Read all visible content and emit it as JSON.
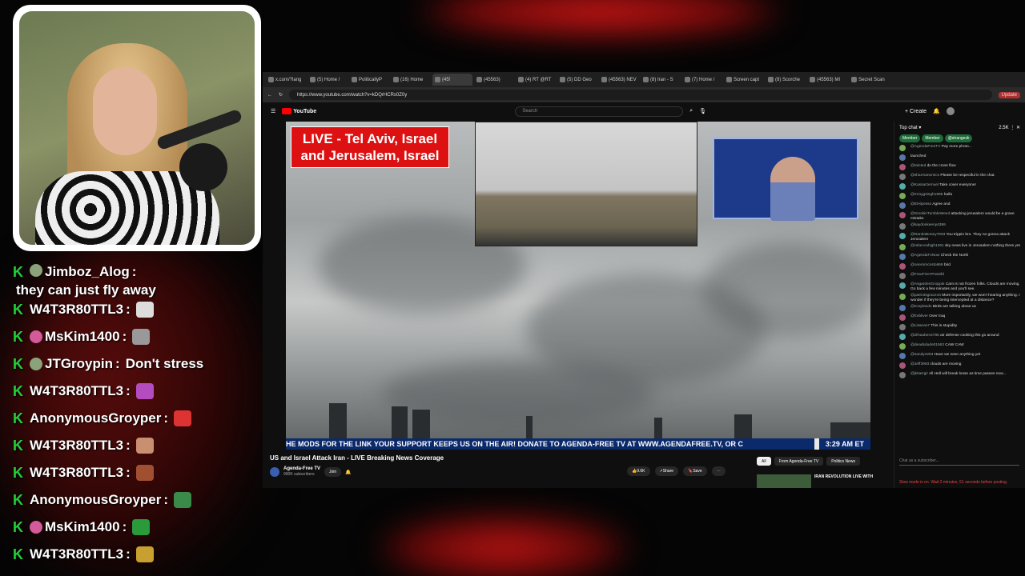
{
  "stream_chat": [
    {
      "user": "Jimboz_Alog",
      "msg": "they can just fly away",
      "badge": "g",
      "emote": ""
    },
    {
      "user": "W4T3R80TTL3",
      "msg": "",
      "badge": "",
      "emote": "#ddd"
    },
    {
      "user": "MsKim1400",
      "msg": "",
      "badge": "p",
      "emote": "#999"
    },
    {
      "user": "JTGroypin",
      "msg": "Don't stress",
      "badge": "g",
      "emote": ""
    },
    {
      "user": "W4T3R80TTL3",
      "msg": "",
      "badge": "",
      "emote": "#b44cc0"
    },
    {
      "user": "AnonymousGroyper",
      "msg": "",
      "badge": "",
      "emote": "#d33"
    },
    {
      "user": "W4T3R80TTL3",
      "msg": "",
      "badge": "",
      "emote": "#c89070"
    },
    {
      "user": "W4T3R80TTL3",
      "msg": "",
      "badge": "",
      "emote": "#a05030"
    },
    {
      "user": "AnonymousGroyper",
      "msg": "",
      "badge": "",
      "emote": "#3a8a4a"
    },
    {
      "user": "MsKim1400",
      "msg": "",
      "badge": "p",
      "emote": "#2a9a3a"
    },
    {
      "user": "W4T3R80TTL3",
      "msg": "",
      "badge": "",
      "emote": "#c8a030"
    }
  ],
  "browser": {
    "tabs": [
      "x.com/?lang",
      "(5) Home /",
      "PoliticallyP",
      "(16) Home",
      "(45!",
      "(45563)",
      "(4) RT @RT",
      "(5) DD Geo",
      "(45563) NEV",
      "(8) Iran - S",
      "(7) Home /",
      "Screen capt",
      "(8) Scorche",
      "(45563) MI",
      "Secret Scan"
    ],
    "url": "https://www.youtube.com/watch?v=kDQrHCRs0Z0y",
    "yt_logo": "YouTube",
    "search_placeholder": "Search",
    "create_label": "Create",
    "update_label": "Update"
  },
  "video": {
    "overlay_title": "LIVE - Tel Aviv, Israel and Jerusalem, Israel",
    "ticker": "HE MODS FOR THE LINK    YOUR SUPPORT KEEPS US ON THE AIR! DONATE TO AGENDA-FREE TV AT WWW.AGENDAFREE.TV, OR C",
    "time": "3:29 AM ET",
    "title": "US and Israel Attack Iran - LIVE Breaking News Coverage",
    "channel": "Agenda-Free TV",
    "subscribers": "990K subscribers",
    "join": "Join",
    "likes": "9.6K",
    "share": "Share",
    "save": "Save"
  },
  "related": {
    "chips": [
      "All",
      "From Agenda-Free TV",
      "Politics News"
    ],
    "first_title": "IRAN REVOLUTION LIVE WITH"
  },
  "live_chat": {
    "header": "Top chat",
    "count": "2.5K",
    "pinned": [
      "Member",
      "Member",
      "@strangesk"
    ],
    "messages": [
      {
        "u": "@AgendaFreeTV",
        "m": "Pay more photo..."
      },
      {
        "u": "",
        "m": "launched"
      },
      {
        "u": "@tainted",
        "m": "do the cross flow"
      },
      {
        "u": "@sharmanomics",
        "m": "Please be respectful in the chat."
      },
      {
        "u": "@KassaGemuel",
        "m": "Take cover everyone!"
      },
      {
        "u": "@mroygsingh1999",
        "m": "haifa"
      },
      {
        "u": "@ElAlpesso",
        "m": "Agree and"
      },
      {
        "u": "@SmokinTumbleWeed",
        "m": "attacking jerusalem would be a grave mistake"
      },
      {
        "u": "@kaydonkeeny4399",
        "m": ""
      },
      {
        "u": "@RandoBoney7693",
        "m": "You trippin bro. They no gonna attack Jerusalem"
      },
      {
        "u": "@rebeccahigh1361",
        "m": "sky news live in Jerusalem nothing there yet"
      },
      {
        "u": "@AgendaTvNow",
        "m": "Check the North"
      },
      {
        "u": "@oneromcosto669",
        "m": "bird"
      },
      {
        "u": "@FreeFireYPosDfd",
        "m": ""
      },
      {
        "u": "@AsgardenGroppie",
        "m": "Cam is not frozen folks. Clouds are moving. Go back a few minutes and you'll see."
      },
      {
        "u": "@patriotsgrace44",
        "m": "More importantly, we won't hearing anything. I wonder if they're being intercepted at a distance?"
      },
      {
        "u": "@Korplands",
        "m": "Birds are talking about us"
      },
      {
        "u": "@forbliver",
        "m": "Over Iraq"
      },
      {
        "u": "@Lissean7",
        "m": "This is stupidity"
      },
      {
        "u": "@drhauben4786",
        "m": "air defense cooking this go around"
      },
      {
        "u": "@deadsdude01563",
        "m": "CAW CAW"
      },
      {
        "u": "@sandy4253",
        "m": "Have we seen anything yet"
      },
      {
        "u": "@Jeff3993",
        "m": "clouds are moving"
      },
      {
        "u": "@jlstarrgir",
        "m": "All Hell will break loose as time passes now..."
      }
    ],
    "input_placeholder": "Chat as a subscriber...",
    "slow_mode": "Slow mode is on. Wait 2 minutes, 51 seconds before posting."
  },
  "colors": {
    "accent_red": "#d11111",
    "twitch_green": "#22d03a",
    "ticker_blue": "#0b2a6b"
  }
}
